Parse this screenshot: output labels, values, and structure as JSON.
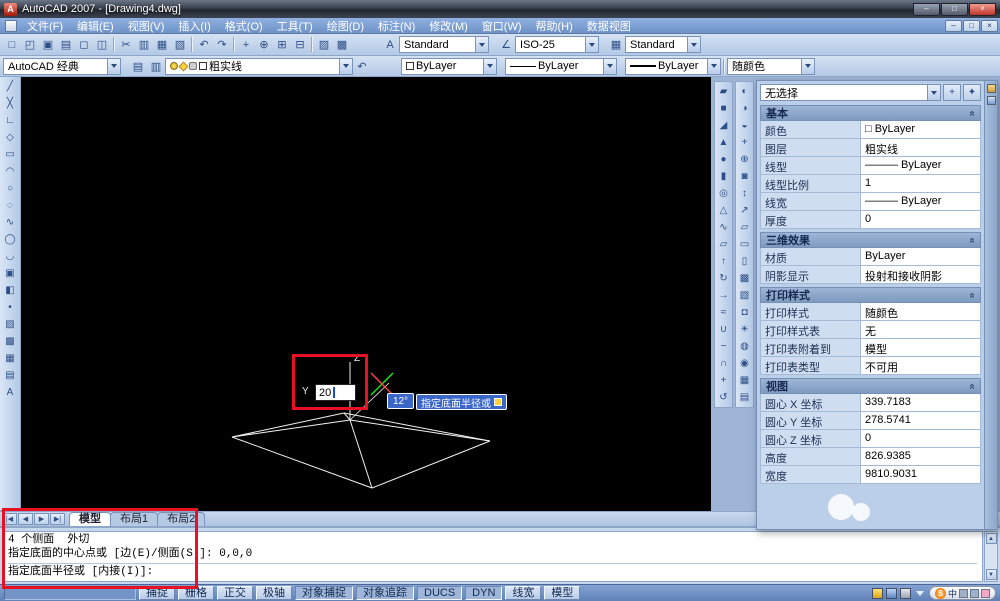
{
  "window": {
    "title": "AutoCAD 2007 - [Drawing4.dwg]",
    "controls": [
      {
        "name": "minimize-button",
        "g": "–"
      },
      {
        "name": "maximize-button",
        "g": "□"
      },
      {
        "name": "close-button",
        "g": "×",
        "cls": "close"
      }
    ]
  },
  "menu": {
    "items": [
      "文件(F)",
      "编辑(E)",
      "视图(V)",
      "插入(I)",
      "格式(O)",
      "工具(T)",
      "绘图(D)",
      "标注(N)",
      "修改(M)",
      "窗口(W)",
      "帮助(H)",
      "数据视图"
    ],
    "doc_controls": [
      {
        "name": "doc-minimize-button",
        "g": "–"
      },
      {
        "name": "doc-restore-button",
        "g": "□"
      },
      {
        "name": "doc-close-button",
        "g": "×"
      }
    ]
  },
  "toolbar1": {
    "icons": [
      {
        "name": "qnew-icon",
        "g": "□"
      },
      {
        "name": "open-icon",
        "g": "◰"
      },
      {
        "name": "save-icon",
        "g": "▣"
      },
      {
        "name": "plot-icon",
        "g": "▤"
      },
      {
        "name": "plot-preview-icon",
        "g": "◻"
      },
      {
        "name": "publish-icon",
        "g": "◫"
      },
      {
        "name": "separator",
        "g": "",
        "cls": "sep"
      },
      {
        "name": "cut-icon",
        "g": "✂"
      },
      {
        "name": "copy-icon",
        "g": "▥"
      },
      {
        "name": "paste-icon",
        "g": "▦"
      },
      {
        "name": "match-properties-icon",
        "g": "▧"
      },
      {
        "name": "separator",
        "g": "",
        "cls": "sep"
      },
      {
        "name": "undo-icon",
        "g": "↶"
      },
      {
        "name": "redo-icon",
        "g": "↷"
      },
      {
        "name": "separator",
        "g": "",
        "cls": "sep"
      },
      {
        "name": "pan-icon",
        "g": "+"
      },
      {
        "name": "zoom-realtime-icon",
        "g": "⊕"
      },
      {
        "name": "zoom-window-icon",
        "g": "⊞"
      },
      {
        "name": "zoom-previous-icon",
        "g": "⊟"
      },
      {
        "name": "separator",
        "g": "",
        "cls": "sep"
      },
      {
        "name": "properties-icon",
        "g": "▨"
      },
      {
        "name": "designcenter-icon",
        "g": "▩"
      }
    ],
    "style_icon": "A",
    "style_combo": "Standard",
    "dim_icon": "∠",
    "dim_combo": "ISO-25",
    "table_icon": "▦",
    "table_combo": "Standard"
  },
  "toolbar2": {
    "workspace_combo": "AutoCAD 经典",
    "icons_a": [
      {
        "name": "layer-properties-icon",
        "g": "▤"
      },
      {
        "name": "layer-states-icon",
        "g": "▥"
      }
    ],
    "layer_name": "粗实线",
    "icons_b": [
      {
        "name": "layer-previous-icon",
        "g": "↶"
      }
    ],
    "color_combo": "ByLayer",
    "linetype_combo": "ByLayer",
    "lineweight_combo": "ByLayer",
    "plotstyle_combo": "随颜色"
  },
  "draw_toolbar": {
    "icons": [
      {
        "name": "line-icon",
        "g": "╱"
      },
      {
        "name": "construction-line-icon",
        "g": "╳"
      },
      {
        "name": "polyline-icon",
        "g": "∟"
      },
      {
        "name": "polygon-icon",
        "g": "◇"
      },
      {
        "name": "rectangle-icon",
        "g": "▭"
      },
      {
        "name": "arc-icon",
        "g": "◠"
      },
      {
        "name": "circle-icon",
        "g": "○"
      },
      {
        "name": "revision-cloud-icon",
        "g": "◌"
      },
      {
        "name": "spline-icon",
        "g": "∿"
      },
      {
        "name": "ellipse-icon",
        "g": "◯"
      },
      {
        "name": "ellipse-arc-icon",
        "g": "◡"
      },
      {
        "name": "insert-block-icon",
        "g": "▣"
      },
      {
        "name": "make-block-icon",
        "g": "◧"
      },
      {
        "name": "point-icon",
        "g": "•"
      },
      {
        "name": "hatch-icon",
        "g": "▨"
      },
      {
        "name": "gradient-icon",
        "g": "▩"
      },
      {
        "name": "region-icon",
        "g": "▦"
      },
      {
        "name": "table-icon",
        "g": "▤"
      },
      {
        "name": "multiline-text-icon",
        "g": "A"
      }
    ]
  },
  "modeling_toolbar": {
    "icons": [
      {
        "name": "polysolid-icon",
        "g": "▰"
      },
      {
        "name": "box-icon",
        "g": "■"
      },
      {
        "name": "wedge-icon",
        "g": "◢"
      },
      {
        "name": "cone-icon",
        "g": "▲"
      },
      {
        "name": "sphere-icon",
        "g": "●"
      },
      {
        "name": "cylinder-icon",
        "g": "▮"
      },
      {
        "name": "torus-icon",
        "g": "◎"
      },
      {
        "name": "pyramid-icon",
        "g": "△"
      },
      {
        "name": "helix-icon",
        "g": "∿"
      },
      {
        "name": "planar-surface-icon",
        "g": "▱"
      },
      {
        "name": "extrude-icon",
        "g": "↑"
      },
      {
        "name": "revolve-icon",
        "g": "↻"
      },
      {
        "name": "sweep-icon",
        "g": "→"
      },
      {
        "name": "loft-icon",
        "g": "≈"
      },
      {
        "name": "union-icon",
        "g": "∪"
      },
      {
        "name": "subtract-icon",
        "g": "−"
      },
      {
        "name": "intersect-icon",
        "g": "∩"
      },
      {
        "name": "3d-move-icon",
        "g": "+"
      },
      {
        "name": "3d-rotate-icon",
        "g": "↺"
      }
    ]
  },
  "view_toolbar": {
    "icons": [
      {
        "name": "constrained-orbit-icon",
        "g": "◐"
      },
      {
        "name": "free-orbit-icon",
        "g": "◑"
      },
      {
        "name": "continuous-orbit-icon",
        "g": "◒"
      },
      {
        "name": "pan-3d-icon",
        "g": "+"
      },
      {
        "name": "zoom-3d-icon",
        "g": "⊕"
      },
      {
        "name": "camera-icon",
        "g": "◙"
      },
      {
        "name": "walk-icon",
        "g": "↕"
      },
      {
        "name": "fly-icon",
        "g": "↗"
      },
      {
        "name": "visual-style-2dwireframe-icon",
        "g": "▱"
      },
      {
        "name": "visual-style-3dwireframe-icon",
        "g": "▭"
      },
      {
        "name": "visual-style-hidden-icon",
        "g": "▯"
      },
      {
        "name": "visual-style-realistic-icon",
        "g": "▩"
      },
      {
        "name": "visual-style-conceptual-icon",
        "g": "▨"
      },
      {
        "name": "render-icon",
        "g": "◘"
      },
      {
        "name": "lights-icon",
        "g": "☀"
      },
      {
        "name": "materials-icon",
        "g": "◍"
      },
      {
        "name": "mapping-icon",
        "g": "◉"
      },
      {
        "name": "background-icon",
        "g": "▦"
      },
      {
        "name": "named-views-icon",
        "g": "▤"
      }
    ]
  },
  "canvas": {
    "dyn_input": "20",
    "angle": "12°",
    "tooltip": "指定底面半径或",
    "z_label": "Z",
    "y_label": "Y"
  },
  "palette": {
    "selection_combo": "无选择",
    "head_icons": [
      {
        "name": "toggle-pickadd-button",
        "g": "+"
      },
      {
        "name": "quick-select-button",
        "g": "✦"
      }
    ],
    "sections": {
      "basic": {
        "title": "基本",
        "rows": [
          {
            "label": "颜色",
            "value": "□ ByLayer"
          },
          {
            "label": "图层",
            "value": "粗实线"
          },
          {
            "label": "线型",
            "value": "——— ByLayer"
          },
          {
            "label": "线型比例",
            "value": "1"
          },
          {
            "label": "线宽",
            "value": "——— ByLayer"
          },
          {
            "label": "厚度",
            "value": "0"
          }
        ]
      },
      "effects": {
        "title": "三维效果",
        "rows": [
          {
            "label": "材质",
            "value": "ByLayer"
          },
          {
            "label": "阴影显示",
            "value": "投射和接收阴影"
          }
        ]
      },
      "plot": {
        "title": "打印样式",
        "rows": [
          {
            "label": "打印样式",
            "value": "随颜色"
          },
          {
            "label": "打印样式表",
            "value": "无"
          },
          {
            "label": "打印表附着到",
            "value": "模型"
          },
          {
            "label": "打印表类型",
            "value": "不可用"
          }
        ]
      },
      "view": {
        "title": "视图",
        "rows": [
          {
            "label": "圆心 X 坐标",
            "value": "339.7183"
          },
          {
            "label": "圆心 Y 坐标",
            "value": "278.5741"
          },
          {
            "label": "圆心 Z 坐标",
            "value": "0"
          },
          {
            "label": "高度",
            "value": "826.9385"
          },
          {
            "label": "宽度",
            "value": "9810.9031"
          }
        ]
      }
    }
  },
  "tabs": {
    "nav": [
      "|◀",
      "◀",
      "▶",
      "▶|"
    ],
    "items": [
      {
        "label": "模型",
        "cls": "active"
      },
      {
        "label": "布局1"
      },
      {
        "label": "布局2"
      }
    ]
  },
  "command": {
    "history": [
      "4 个侧面  外切",
      "指定底面的中心点或 [边(E)/侧面(S)]: 0,0,0"
    ],
    "prompt": "指定底面半径或 [内接(I)]:"
  },
  "statusbar": {
    "buttons": [
      {
        "label": "捕捉"
      },
      {
        "label": "栅格"
      },
      {
        "label": "正交"
      },
      {
        "label": "极轴"
      },
      {
        "label": "对象捕捉",
        "cls": "pressed"
      },
      {
        "label": "对象追踪",
        "cls": "pressed"
      },
      {
        "label": "DUCS",
        "cls": "pressed"
      },
      {
        "label": "DYN",
        "cls": "pressed"
      },
      {
        "label": "线宽"
      },
      {
        "label": "模型"
      }
    ]
  },
  "ime": {
    "logo": "S",
    "mode": "中"
  },
  "ui": {
    "chevron": "«",
    "up": "▲",
    "down": "▼"
  },
  "colors": {
    "canvas_bg": "#000000",
    "highlight_red": "#e81123",
    "dyn_tooltip_blue": "#3a66c8",
    "toolbar_blue": "#b3c9e6"
  }
}
